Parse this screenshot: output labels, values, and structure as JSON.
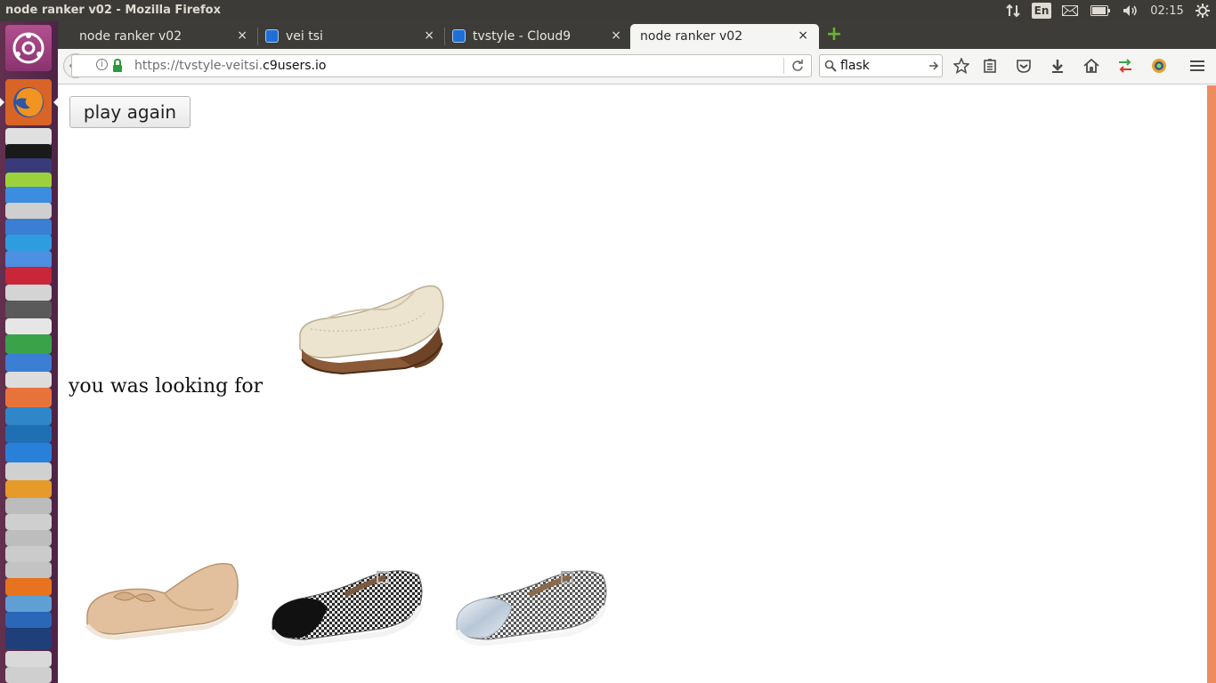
{
  "window": {
    "title": "node ranker v02 - Mozilla Firefox"
  },
  "system": {
    "keyboard": "En",
    "time": "02:15"
  },
  "tabs": [
    {
      "label": "node ranker v02",
      "close": "×",
      "selected": false
    },
    {
      "label": "vei tsi",
      "close": "×",
      "selected": false
    },
    {
      "label": "tvstyle - Cloud9",
      "close": "×",
      "selected": false
    },
    {
      "label": "node ranker v02",
      "close": "×",
      "selected": true
    }
  ],
  "new_tab": "+",
  "url": {
    "prefix": "https://tvstyle-veitsi.",
    "domain": "c9users.io"
  },
  "search": {
    "value": "flask"
  },
  "page": {
    "play_again": "play again",
    "looking_for": "you was looking for"
  },
  "colors": {
    "scrollbar": "#ee8b5f",
    "accent": "#e95420"
  }
}
